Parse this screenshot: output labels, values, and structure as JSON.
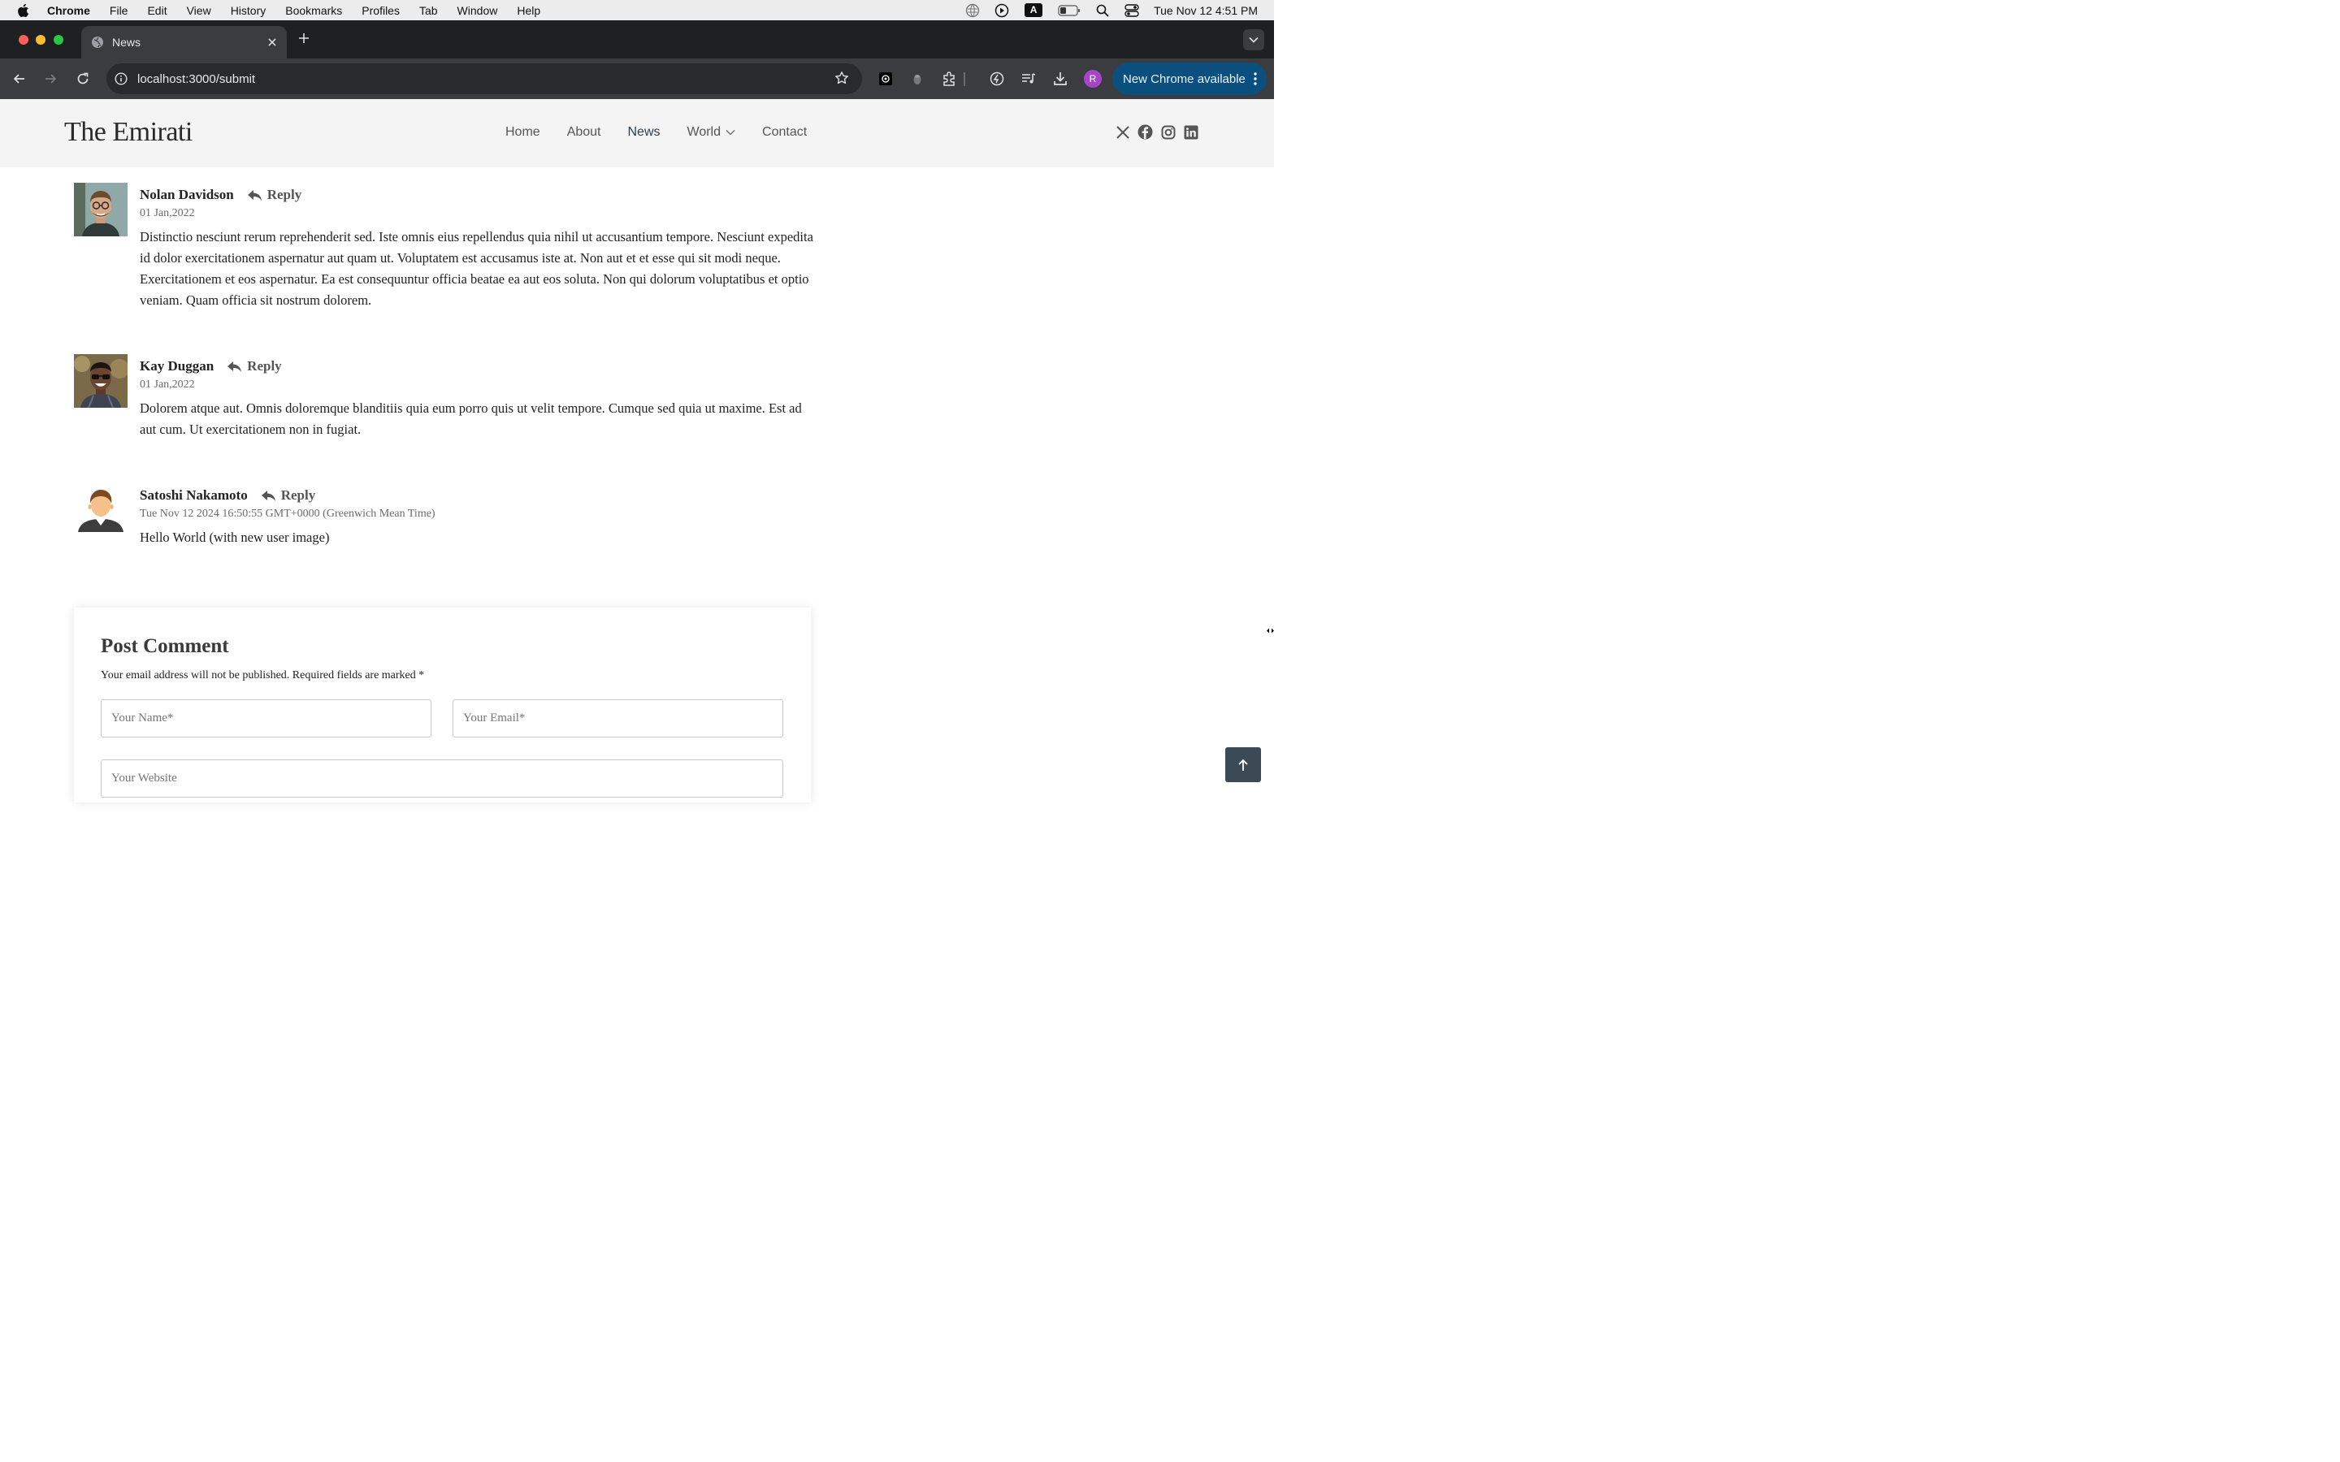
{
  "menubar": {
    "app": "Chrome",
    "items": [
      "File",
      "Edit",
      "View",
      "History",
      "Bookmarks",
      "Profiles",
      "Tab",
      "Window",
      "Help"
    ],
    "clock": "Tue Nov 12  4:51 PM",
    "input_indicator": "A"
  },
  "browser": {
    "tab_title": "News",
    "url": "localhost:3000/submit",
    "profile_initial": "R",
    "update_label": "New Chrome available"
  },
  "site": {
    "logo": "The Emirati",
    "nav": [
      "Home",
      "About",
      "News",
      "World",
      "Contact"
    ],
    "social": [
      "x-icon",
      "facebook-icon",
      "instagram-icon",
      "linkedin-icon"
    ]
  },
  "comments": [
    {
      "name": "Nolan Davidson",
      "reply": "Reply",
      "date": "01 Jan,2022",
      "text": "Distinctio nesciunt rerum reprehenderit sed. Iste omnis eius repellendus quia nihil ut accusantium tempore. Nesciunt expedita id dolor exercitationem aspernatur aut quam ut. Voluptatem est accusamus iste at. Non aut et et esse qui sit modi neque. Exercitationem et eos aspernatur. Ea est consequuntur officia beatae ea aut eos soluta. Non qui dolorum voluptatibus et optio veniam. Quam officia sit nostrum dolorem."
    },
    {
      "name": "Kay Duggan",
      "reply": "Reply",
      "date": "01 Jan,2022",
      "text": "Dolorem atque aut. Omnis doloremque blanditiis quia eum porro quis ut velit tempore. Cumque sed quia ut maxime. Est ad aut cum. Ut exercitationem non in fugiat."
    },
    {
      "name": "Satoshi Nakamoto",
      "reply": "Reply",
      "date": "Tue Nov 12 2024 16:50:55 GMT+0000 (Greenwich Mean Time)",
      "text": "Hello World (with new user image)"
    }
  ],
  "form": {
    "title": "Post Comment",
    "note": "Your email address will not be published. Required fields are marked *",
    "name_placeholder": "Your Name*",
    "email_placeholder": "Your Email*",
    "website_placeholder": "Your Website"
  },
  "colors": {
    "accent": "#0b4f7e",
    "header_bg": "#f4f4f4",
    "to_top_bg": "#3c4a55"
  }
}
